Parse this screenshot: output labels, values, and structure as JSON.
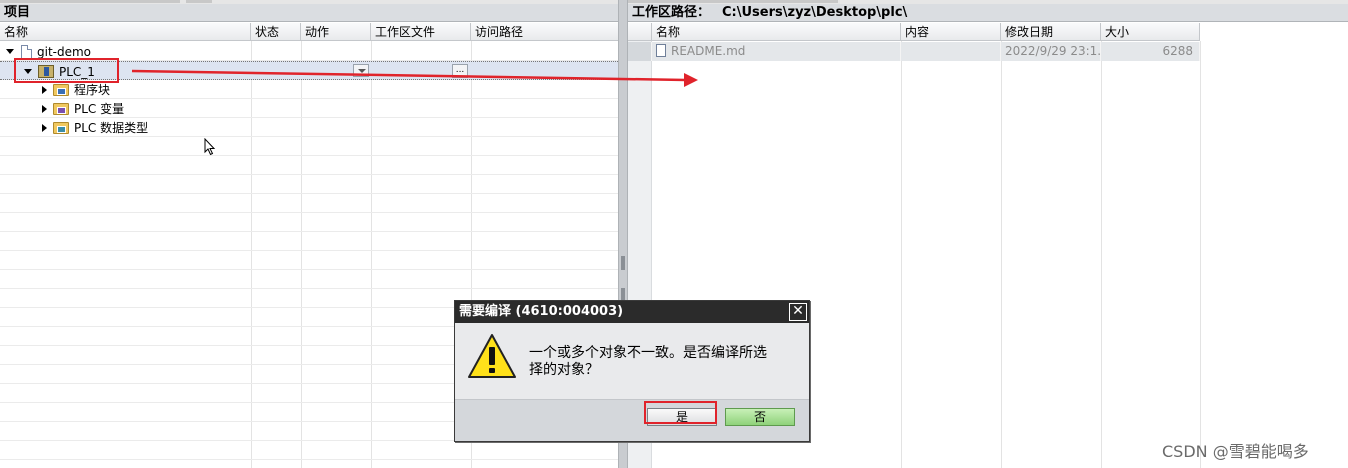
{
  "project_panel": {
    "title": "项目",
    "columns": [
      "名称",
      "状态",
      "动作",
      "工作区文件",
      "访问路径"
    ],
    "tree": [
      {
        "label": "git-demo",
        "icon": "project-doc-icon",
        "expanded": true
      },
      {
        "label": "PLC_1",
        "icon": "plc-device-icon",
        "expanded": true,
        "selected": true
      },
      {
        "label": "程序块",
        "icon": "program-blocks-folder-icon",
        "expanded": false
      },
      {
        "label": "PLC 变量",
        "icon": "plc-tags-folder-icon",
        "expanded": false
      },
      {
        "label": "PLC 数据类型",
        "icon": "plc-datatypes-folder-icon",
        "expanded": false
      }
    ],
    "ellipsis_button": "..."
  },
  "workspace_panel": {
    "title": "工作区路径：",
    "path": "C:\\Users\\zyz\\Desktop\\plc\\",
    "columns": [
      "名称",
      "内容",
      "修改日期",
      "大小"
    ],
    "files": [
      {
        "name": "README.md",
        "icon": "file-icon",
        "content": "",
        "modified": "2022/9/29 23:1...",
        "size": "6288"
      }
    ]
  },
  "dialog": {
    "title": "需要编译 (4610:004003)",
    "close_label": "✕",
    "icon": "warning-icon",
    "message_line1": "一个或多个对象不一致。是否编译所选",
    "message_line2": "择的对象？",
    "yes_label": "是",
    "no_label": "否"
  },
  "annotations": {
    "color": "#e0232b"
  },
  "watermark": "CSDN @雪碧能喝多"
}
